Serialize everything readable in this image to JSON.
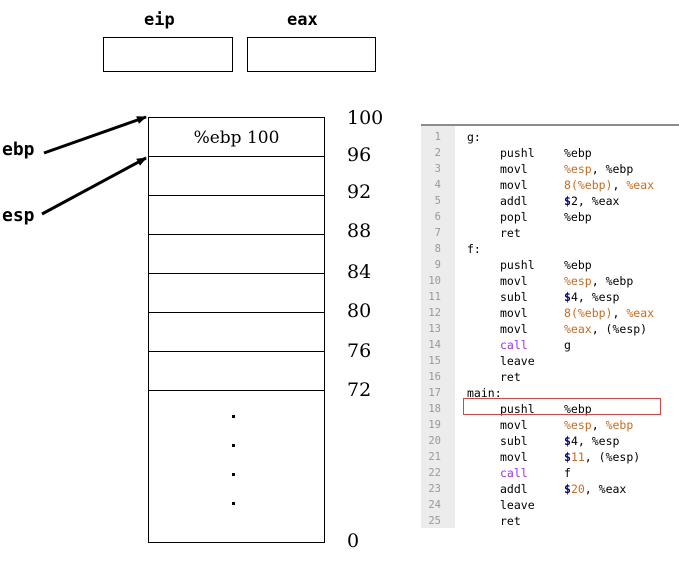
{
  "registers": {
    "eip_label": "eip",
    "eax_label": "eax",
    "eip_value": "",
    "eax_value": ""
  },
  "pointers": {
    "ebp_label": "ebp",
    "esp_label": "esp"
  },
  "stack": {
    "top_slot_text": "%ebp 100",
    "addresses": [
      "100",
      "96",
      "92",
      "88",
      "84",
      "80",
      "76",
      "72",
      "0"
    ]
  },
  "code": {
    "lines": [
      {
        "n": "1",
        "label": "g:",
        "mnem": "",
        "ops": []
      },
      {
        "n": "2",
        "label": "",
        "mnem": "pushl",
        "ops": [
          {
            "t": "%ebp",
            "c": "plain"
          }
        ]
      },
      {
        "n": "3",
        "label": "",
        "mnem": "movl",
        "ops": [
          {
            "t": "%esp",
            "c": "reg"
          },
          {
            "t": ", ",
            "c": "plain"
          },
          {
            "t": "%ebp",
            "c": "plain"
          }
        ]
      },
      {
        "n": "4",
        "label": "",
        "mnem": "movl",
        "ops": [
          {
            "t": "8",
            "c": "num"
          },
          {
            "t": "(%ebp)",
            "c": "reg"
          },
          {
            "t": ", ",
            "c": "plain"
          },
          {
            "t": "%eax",
            "c": "reg"
          }
        ]
      },
      {
        "n": "5",
        "label": "",
        "mnem": "addl",
        "ops": [
          {
            "t": "$",
            "c": "dollar"
          },
          {
            "t": "2",
            "c": "plain"
          },
          {
            "t": ", %eax",
            "c": "plain"
          }
        ]
      },
      {
        "n": "6",
        "label": "",
        "mnem": "popl",
        "ops": [
          {
            "t": "%ebp",
            "c": "plain"
          }
        ]
      },
      {
        "n": "7",
        "label": "",
        "mnem": "ret",
        "ops": []
      },
      {
        "n": "8",
        "label": "f:",
        "mnem": "",
        "ops": []
      },
      {
        "n": "9",
        "label": "",
        "mnem": "pushl",
        "ops": [
          {
            "t": "%ebp",
            "c": "plain"
          }
        ]
      },
      {
        "n": "10",
        "label": "",
        "mnem": "movl",
        "ops": [
          {
            "t": "%esp",
            "c": "reg"
          },
          {
            "t": ", ",
            "c": "plain"
          },
          {
            "t": "%ebp",
            "c": "plain"
          }
        ]
      },
      {
        "n": "11",
        "label": "",
        "mnem": "subl",
        "ops": [
          {
            "t": "$",
            "c": "dollar"
          },
          {
            "t": "4",
            "c": "plain"
          },
          {
            "t": ", %esp",
            "c": "plain"
          }
        ]
      },
      {
        "n": "12",
        "label": "",
        "mnem": "movl",
        "ops": [
          {
            "t": "8",
            "c": "num"
          },
          {
            "t": "(%ebp)",
            "c": "reg"
          },
          {
            "t": ", ",
            "c": "plain"
          },
          {
            "t": "%eax",
            "c": "reg"
          }
        ]
      },
      {
        "n": "13",
        "label": "",
        "mnem": "movl",
        "ops": [
          {
            "t": "%eax",
            "c": "reg"
          },
          {
            "t": ", (%esp)",
            "c": "plain"
          }
        ]
      },
      {
        "n": "14",
        "label": "",
        "mnem": "call",
        "ops": [
          {
            "t": "g",
            "c": "plain"
          }
        ]
      },
      {
        "n": "15",
        "label": "",
        "mnem": "leave",
        "ops": []
      },
      {
        "n": "16",
        "label": "",
        "mnem": "ret",
        "ops": []
      },
      {
        "n": "17",
        "label": "main:",
        "mnem": "",
        "ops": []
      },
      {
        "n": "18",
        "label": "",
        "mnem": "pushl",
        "ops": [
          {
            "t": "%ebp",
            "c": "plain"
          }
        ]
      },
      {
        "n": "19",
        "label": "",
        "mnem": "movl",
        "ops": [
          {
            "t": "%esp",
            "c": "reg"
          },
          {
            "t": ", ",
            "c": "plain"
          },
          {
            "t": "%ebp",
            "c": "reg"
          }
        ]
      },
      {
        "n": "20",
        "label": "",
        "mnem": "subl",
        "ops": [
          {
            "t": "$",
            "c": "dollar"
          },
          {
            "t": "4",
            "c": "plain"
          },
          {
            "t": ", %esp",
            "c": "plain"
          }
        ]
      },
      {
        "n": "21",
        "label": "",
        "mnem": "movl",
        "ops": [
          {
            "t": "$",
            "c": "dollar"
          },
          {
            "t": "11",
            "c": "num"
          },
          {
            "t": ", (%esp)",
            "c": "plain"
          }
        ]
      },
      {
        "n": "22",
        "label": "",
        "mnem": "call",
        "ops": [
          {
            "t": "f",
            "c": "plain"
          }
        ]
      },
      {
        "n": "23",
        "label": "",
        "mnem": "addl",
        "ops": [
          {
            "t": "$",
            "c": "dollar"
          },
          {
            "t": "20",
            "c": "num"
          },
          {
            "t": ", %eax",
            "c": "plain"
          }
        ]
      },
      {
        "n": "24",
        "label": "",
        "mnem": "leave",
        "ops": []
      },
      {
        "n": "25",
        "label": "",
        "mnem": "ret",
        "ops": []
      }
    ],
    "highlighted_line": "18"
  },
  "colors": {
    "register_operand": "#cc6a1e",
    "immediate_marker": "#000080",
    "call_keyword": "#9b30ff",
    "highlight_border": "#e04040",
    "gutter": "#ececec"
  }
}
